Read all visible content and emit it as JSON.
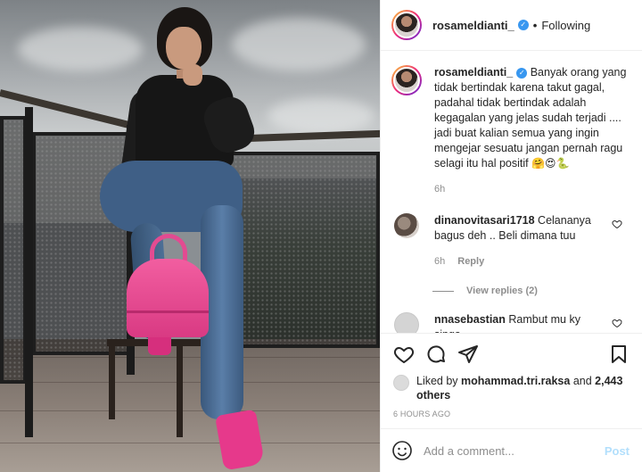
{
  "header": {
    "username": "rosameldianti_",
    "separator": "•",
    "follow_status": "Following"
  },
  "caption": {
    "username": "rosameldianti_",
    "text": "Banyak orang yang tidak bertindak karena takut gagal, padahal tidak bertindak adalah kegagalan yang jelas sudah terjadi .... jadi buat kalian semua yang ingin mengejar sesuatu jangan pernah ragu selagi itu hal positif",
    "emojis": "🤗😍🐍",
    "time": "6h"
  },
  "comments": [
    {
      "username": "dinanovitasari1718",
      "text": "Celananya bagus deh .. Beli dimana tuu",
      "time": "6h",
      "reply_label": "Reply",
      "view_replies": "View replies (2)"
    },
    {
      "username": "nnasebastian",
      "text": "Rambut mu ky singa"
    }
  ],
  "likes": {
    "prefix": "Liked by",
    "user": "mohammad.tri.raksa",
    "and": "and",
    "others": "2,443 others"
  },
  "post_time": "6 HOURS AGO",
  "add_comment": {
    "placeholder": "Add a comment...",
    "post_label": "Post"
  },
  "icons": {
    "verified": "verified-badge-icon",
    "like": "heart-icon",
    "comment": "comment-icon",
    "share": "paper-plane-icon",
    "save": "bookmark-icon",
    "emoji": "smiley-icon"
  },
  "colors": {
    "verified_blue": "#3897f0",
    "muted_text": "#8e8e8e",
    "post_button_disabled": "#b2dffc"
  }
}
